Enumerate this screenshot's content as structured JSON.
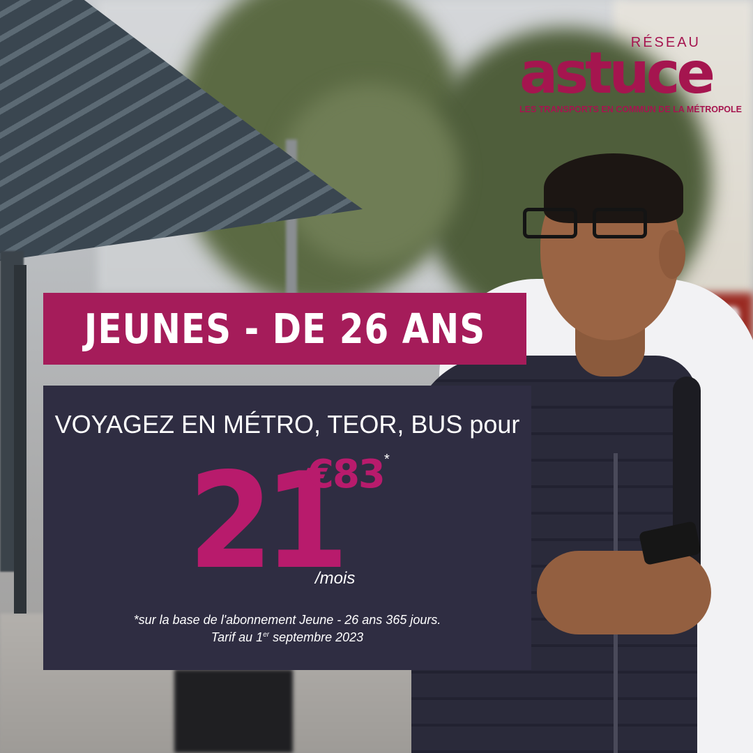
{
  "logo": {
    "reseau": "RÉSEAU",
    "brand": "astuce",
    "tagline": "LES TRANSPORTS EN COMMUN DE LA MÉTROPOLE"
  },
  "banner": {
    "title": "JEUNES - DE 26 ANS"
  },
  "offer": {
    "headline": "VOYAGEZ EN MÉTRO, TEOR, BUS pour",
    "price_euros": "21",
    "price_cents": "€83",
    "asterisk": "*",
    "unit": "/mois",
    "footnote_line1": "*sur la base de l'abonnement Jeune - 26 ans  365 jours.",
    "footnote_line2_prefix": "Tarif au 1",
    "footnote_line2_sup": "er",
    "footnote_line2_suffix": " septembre 2023"
  },
  "colors": {
    "brand": "#a5154f",
    "banner": "#a51c5a",
    "panel": "#2f2d42",
    "price": "#b81b6c"
  }
}
